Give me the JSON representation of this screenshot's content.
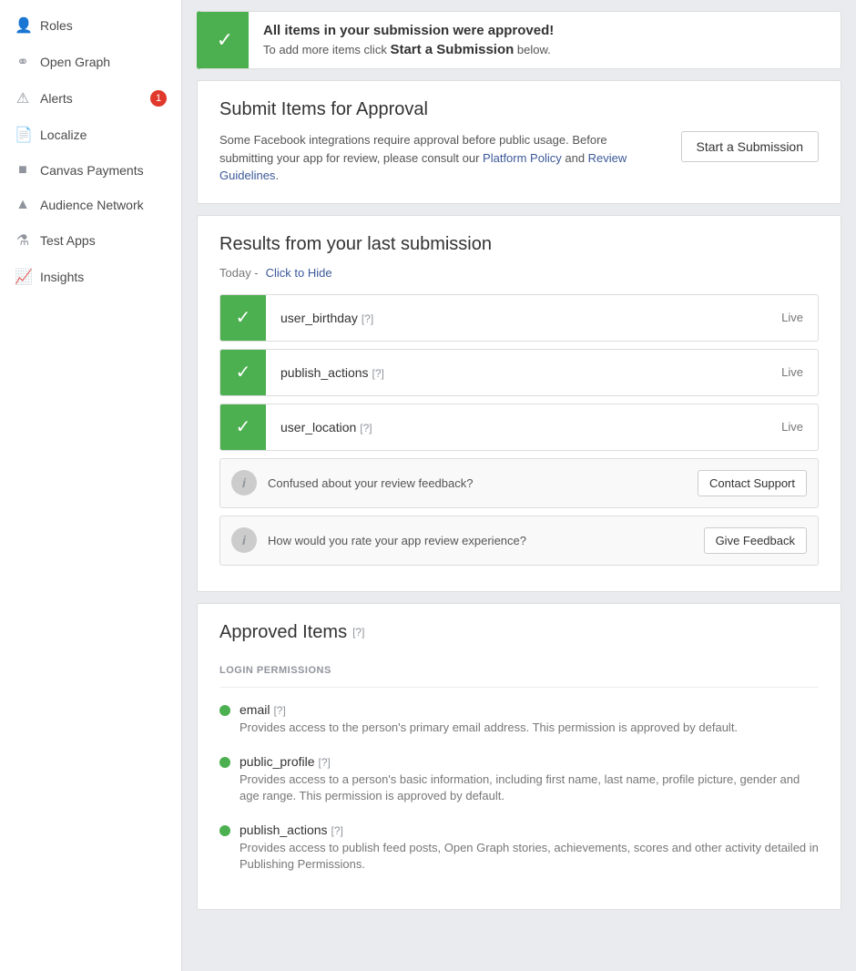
{
  "sidebar": {
    "items": [
      {
        "id": "roles",
        "label": "Roles",
        "icon": "person"
      },
      {
        "id": "open-graph",
        "label": "Open Graph",
        "icon": "graph"
      },
      {
        "id": "alerts",
        "label": "Alerts",
        "icon": "bell",
        "badge": "1"
      },
      {
        "id": "localize",
        "label": "Localize",
        "icon": "book"
      },
      {
        "id": "canvas-payments",
        "label": "Canvas Payments",
        "icon": "card"
      },
      {
        "id": "audience-network",
        "label": "Audience Network",
        "icon": "network"
      },
      {
        "id": "test-apps",
        "label": "Test Apps",
        "icon": "flask"
      },
      {
        "id": "insights",
        "label": "Insights",
        "icon": "chart"
      }
    ]
  },
  "banner": {
    "title": "All items in your submission were approved!",
    "description": "To add more items click ",
    "link_text": "Start a Submission",
    "description_end": " below."
  },
  "submit_section": {
    "title": "Submit Items for Approval",
    "description": "Some Facebook integrations require approval before public usage. Before submitting your app for review, please consult our ",
    "link1": "Platform Policy",
    "link1_between": " and ",
    "link2": "Review Guidelines",
    "description_end": ".",
    "button": "Start a Submission"
  },
  "results_section": {
    "title": "Results from your last submission",
    "date_label": "Today - ",
    "hide_link": "Click to Hide",
    "items": [
      {
        "name": "user_birthday",
        "help": "[?]",
        "status": "Live"
      },
      {
        "name": "publish_actions",
        "help": "[?]",
        "status": "Live"
      },
      {
        "name": "user_location",
        "help": "[?]",
        "status": "Live"
      }
    ],
    "confused_text": "Confused about your review feedback?",
    "contact_support": "Contact Support",
    "feedback_text": "How would you rate your app review experience?",
    "give_feedback": "Give Feedback"
  },
  "approved_section": {
    "title": "Approved Items",
    "title_help": "[?]",
    "section_label": "LOGIN PERMISSIONS",
    "permissions": [
      {
        "name": "email",
        "help": "[?]",
        "description": "Provides access to the person's primary email address. This permission is approved by default."
      },
      {
        "name": "public_profile",
        "help": "[?]",
        "description": "Provides access to a person's basic information, including first name, last name, profile picture, gender and age range. This permission is approved by default."
      },
      {
        "name": "publish_actions",
        "help": "[?]",
        "description": "Provides access to publish feed posts, Open Graph stories, achievements, scores and other activity detailed in Publishing Permissions."
      }
    ]
  }
}
